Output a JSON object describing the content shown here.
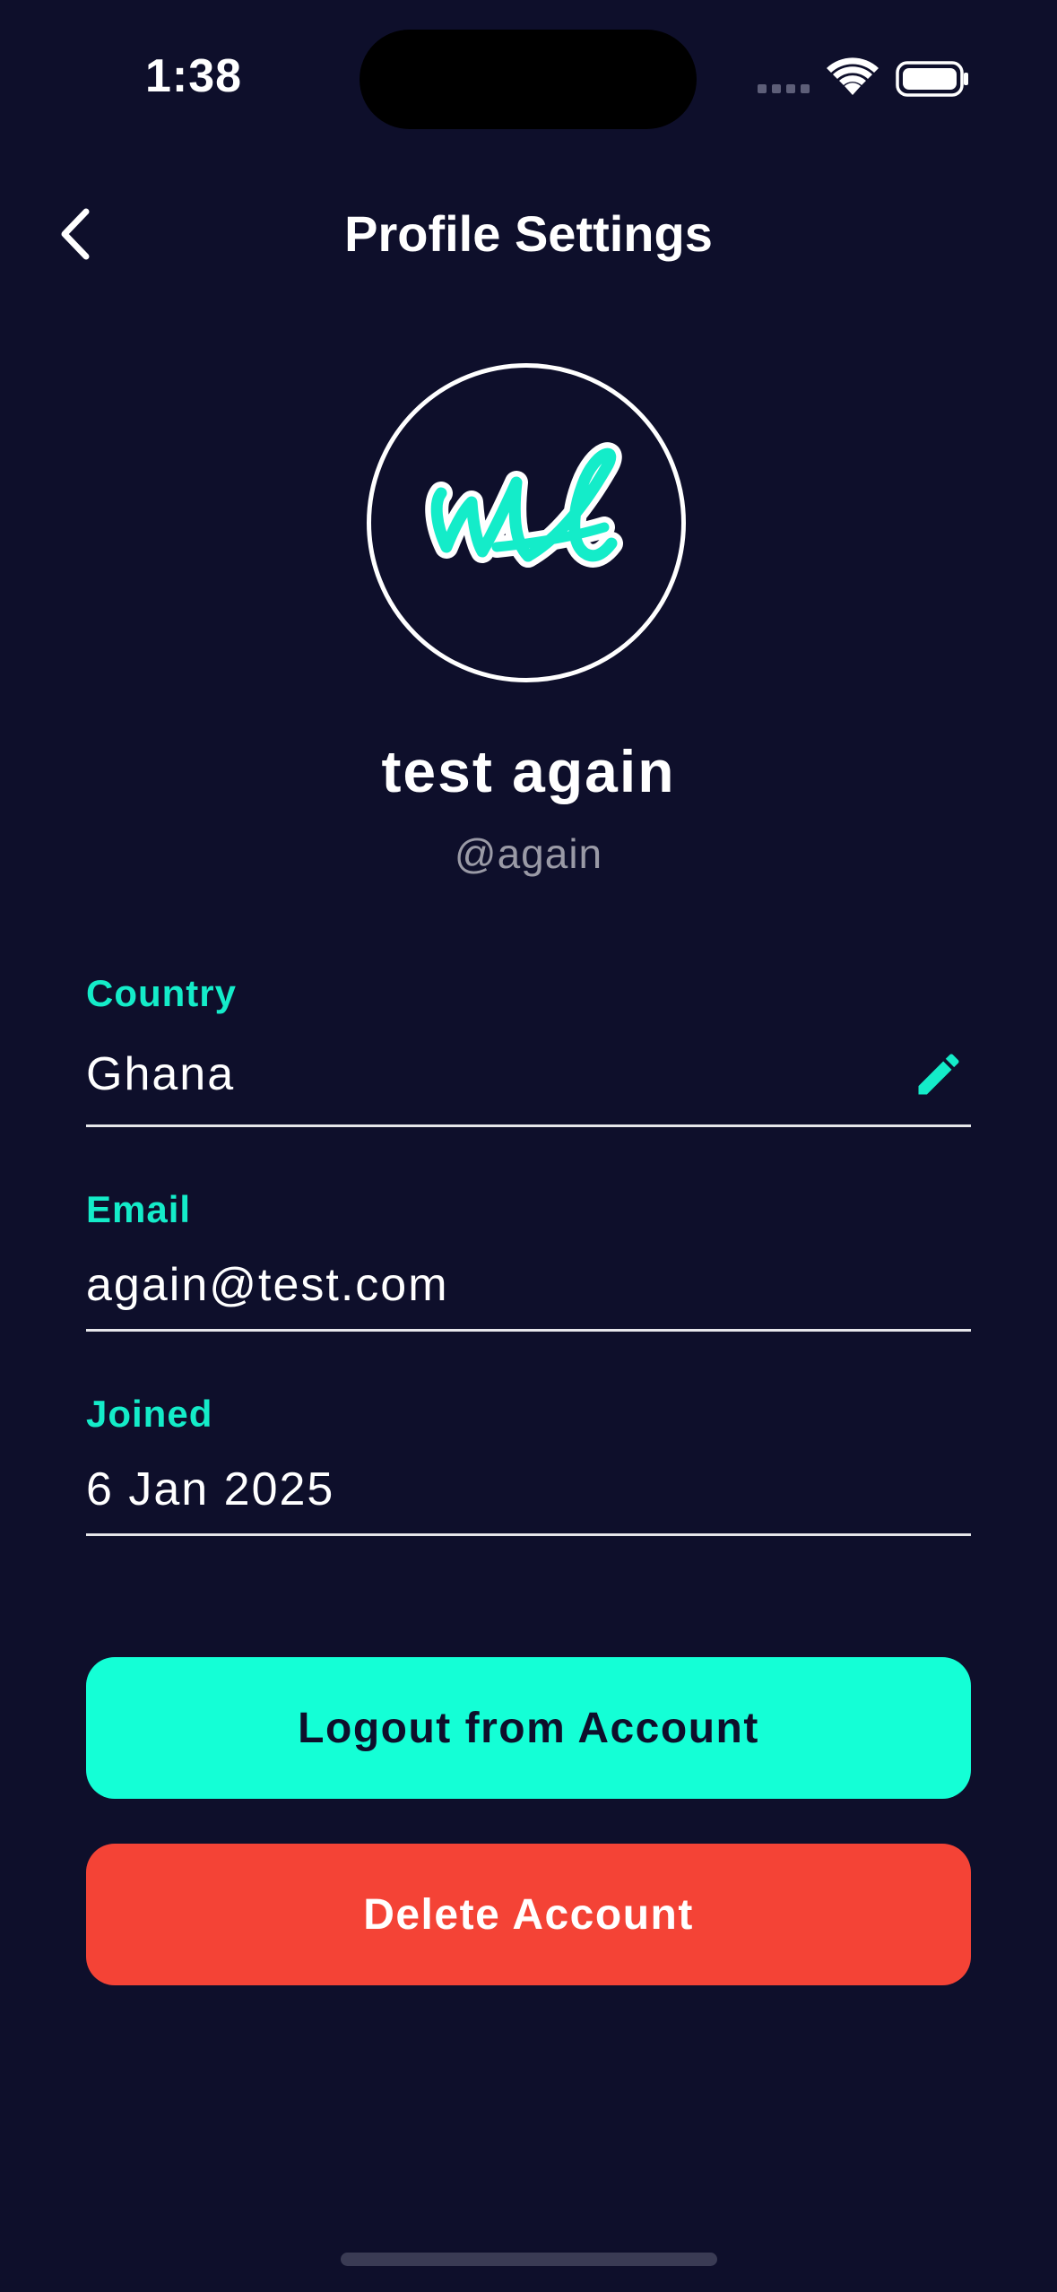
{
  "status_bar": {
    "time": "1:38"
  },
  "header": {
    "title": "Profile Settings",
    "back_icon": "chevron-left-icon"
  },
  "profile": {
    "name": "test again",
    "handle": "@again",
    "avatar_icon": "wl-logo",
    "accent_color": "#14ecc9"
  },
  "fields": [
    {
      "label": "Country",
      "value": "Ghana",
      "editable": true,
      "icon": "pencil-icon"
    },
    {
      "label": "Email",
      "value": "again@test.com",
      "editable": false
    },
    {
      "label": "Joined",
      "value": "6 Jan 2025",
      "editable": false
    }
  ],
  "actions": {
    "logout_label": "Logout from Account",
    "delete_label": "Delete Account",
    "logout_color": "#14ffd6",
    "delete_color": "#f44336"
  },
  "theme": {
    "background": "#0e0f2b"
  }
}
